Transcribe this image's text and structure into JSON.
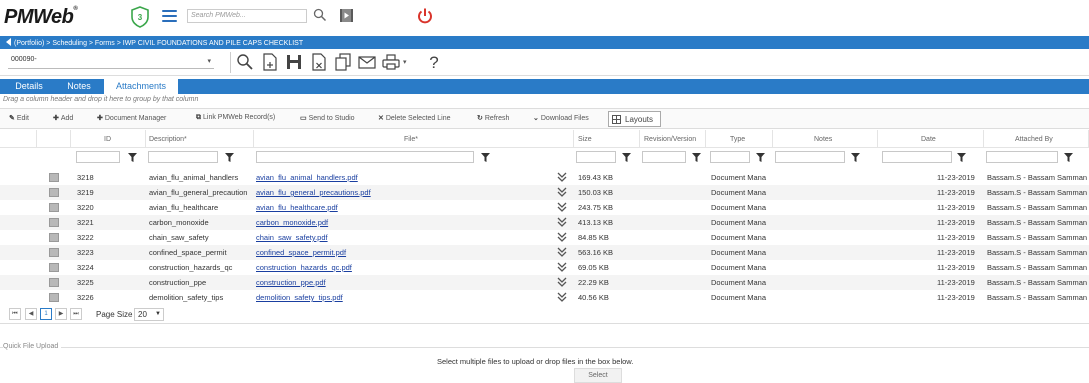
{
  "app": {
    "logo_text": "PMWeb",
    "logo_reg": "®",
    "shield_count": "3",
    "search_placeholder": "Search PMWeb..."
  },
  "breadcrumb": {
    "text": "(Portfolio) > Scheduling > Forms > IWP CIVIL FOUNDATIONS AND PILE CAPS CHECKLIST"
  },
  "record": {
    "selected": "000090-"
  },
  "tabs": [
    {
      "label": "Details",
      "active": false
    },
    {
      "label": "Notes",
      "active": false
    },
    {
      "label": "Attachments",
      "active": true
    }
  ],
  "group_hint": "Drag a column header and drop it here to group by that column",
  "actions": {
    "edit": "Edit",
    "add": "Add",
    "document_manager": "Document Manager",
    "link_records": "Link PMWeb Record(s)",
    "send_to_studio": "Send to Studio",
    "delete_selected": "Delete Selected Line",
    "refresh": "Refresh",
    "download_files": "Download Files",
    "layouts": "Layouts"
  },
  "columns": {
    "id": "ID",
    "description": "Description*",
    "file": "File*",
    "size": "Size",
    "revision": "Revision/Version",
    "type": "Type",
    "notes": "Notes",
    "date": "Date",
    "attached_by": "Attached By"
  },
  "rows": [
    {
      "id": "3218",
      "description": "avian_flu_animal_handlers",
      "file": "avian_flu_animal_handlers.pdf",
      "size": "169.43 KB",
      "type": "Document Mana",
      "date": "11-23-2019",
      "attached_by": "Bassam.S - Bassam Samman"
    },
    {
      "id": "3219",
      "description": "avian_flu_general_precaution",
      "file": "avian_flu_general_precautions.pdf",
      "size": "150.03 KB",
      "type": "Document Mana",
      "date": "11-23-2019",
      "attached_by": "Bassam.S - Bassam Samman"
    },
    {
      "id": "3220",
      "description": "avian_flu_healthcare",
      "file": "avian_flu_healthcare.pdf",
      "size": "243.75 KB",
      "type": "Document Mana",
      "date": "11-23-2019",
      "attached_by": "Bassam.S - Bassam Samman"
    },
    {
      "id": "3221",
      "description": "carbon_monoxide",
      "file": "carbon_monoxide.pdf",
      "size": "413.13 KB",
      "type": "Document Mana",
      "date": "11-23-2019",
      "attached_by": "Bassam.S - Bassam Samman"
    },
    {
      "id": "3222",
      "description": "chain_saw_safety",
      "file": "chain_saw_safety.pdf",
      "size": "84.85 KB",
      "type": "Document Mana",
      "date": "11-23-2019",
      "attached_by": "Bassam.S - Bassam Samman"
    },
    {
      "id": "3223",
      "description": "confined_space_permit",
      "file": "confined_space_permit.pdf",
      "size": "563.16 KB",
      "type": "Document Mana",
      "date": "11-23-2019",
      "attached_by": "Bassam.S - Bassam Samman"
    },
    {
      "id": "3224",
      "description": "construction_hazards_qc",
      "file": "construction_hazards_qc.pdf",
      "size": "69.05 KB",
      "type": "Document Mana",
      "date": "11-23-2019",
      "attached_by": "Bassam.S - Bassam Samman"
    },
    {
      "id": "3225",
      "description": "construction_ppe",
      "file": "construction_ppe.pdf",
      "size": "22.29 KB",
      "type": "Document Mana",
      "date": "11-23-2019",
      "attached_by": "Bassam.S - Bassam Samman"
    },
    {
      "id": "3226",
      "description": "demolition_safety_tips",
      "file": "demolition_safety_tips.pdf",
      "size": "40.56 KB",
      "type": "Document Mana",
      "date": "11-23-2019",
      "attached_by": "Bassam.S - Bassam Samman"
    }
  ],
  "pager": {
    "current_page": "1",
    "page_size_label": "Page Size",
    "page_size": "20"
  },
  "upload": {
    "label": "Quick File Upload",
    "instructions": "Select multiple files to upload or drop files in the box below.",
    "select_label": "Select"
  },
  "colors": {
    "accent": "#2a7bc7",
    "power": "#d9342b",
    "shield": "#3aa64a",
    "link": "#1a3fa0"
  }
}
